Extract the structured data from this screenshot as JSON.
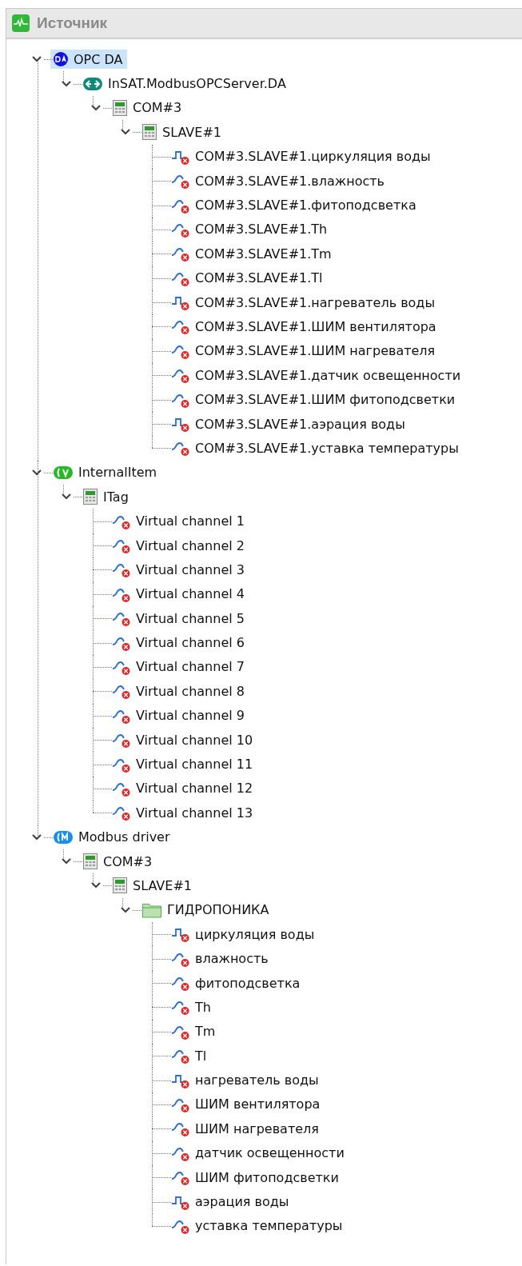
{
  "panel": {
    "title": "Источник"
  },
  "tree": [
    {
      "kind": "server",
      "label": "OPC DA",
      "expanded": true,
      "selected": true,
      "children": [
        {
          "kind": "opc",
          "label": "InSAT.ModbusOPCServer.DA",
          "expanded": true,
          "selected": false,
          "children": [
            {
              "kind": "device",
              "label": "COM#3",
              "expanded": true,
              "selected": false,
              "children": [
                {
                  "kind": "device",
                  "label": "SLAVE#1",
                  "expanded": true,
                  "selected": false,
                  "children": [
                    {
                      "kind": "discrete",
                      "label": "COM#3.SLAVE#1.циркуляция воды",
                      "error": true,
                      "selected": false
                    },
                    {
                      "kind": "analog",
                      "label": "COM#3.SLAVE#1.влажность",
                      "error": true,
                      "selected": false
                    },
                    {
                      "kind": "analog",
                      "label": "COM#3.SLAVE#1.фитоподсветка",
                      "error": true,
                      "selected": false
                    },
                    {
                      "kind": "analog",
                      "label": "COM#3.SLAVE#1.Th",
                      "error": true,
                      "selected": false
                    },
                    {
                      "kind": "analog",
                      "label": "COM#3.SLAVE#1.Tm",
                      "error": true,
                      "selected": false
                    },
                    {
                      "kind": "analog",
                      "label": "COM#3.SLAVE#1.Tl",
                      "error": true,
                      "selected": false
                    },
                    {
                      "kind": "discrete",
                      "label": "COM#3.SLAVE#1.нагреватель воды",
                      "error": true,
                      "selected": false
                    },
                    {
                      "kind": "analog",
                      "label": "COM#3.SLAVE#1.ШИМ вентилятора",
                      "error": true,
                      "selected": false
                    },
                    {
                      "kind": "analog",
                      "label": "COM#3.SLAVE#1.ШИМ нагревателя",
                      "error": true,
                      "selected": false
                    },
                    {
                      "kind": "analog",
                      "label": "COM#3.SLAVE#1.датчик освещенности",
                      "error": true,
                      "selected": false
                    },
                    {
                      "kind": "analog",
                      "label": "COM#3.SLAVE#1.ШИМ фитоподсветки",
                      "error": true,
                      "selected": false
                    },
                    {
                      "kind": "discrete",
                      "label": "COM#3.SLAVE#1.аэрация воды",
                      "error": true,
                      "selected": false
                    },
                    {
                      "kind": "analog",
                      "label": "COM#3.SLAVE#1.уставка температуры",
                      "error": true,
                      "selected": false
                    }
                  ]
                }
              ]
            }
          ]
        }
      ]
    },
    {
      "kind": "virtual",
      "label": "InternalItem",
      "expanded": true,
      "selected": false,
      "children": [
        {
          "kind": "device",
          "label": "ITag",
          "expanded": true,
          "selected": false,
          "children": [
            {
              "kind": "analog",
              "label": "Virtual channel 1",
              "error": true,
              "selected": false
            },
            {
              "kind": "analog",
              "label": "Virtual channel 2",
              "error": true,
              "selected": false
            },
            {
              "kind": "analog",
              "label": "Virtual channel 3",
              "error": true,
              "selected": false
            },
            {
              "kind": "analog",
              "label": "Virtual channel 4",
              "error": true,
              "selected": false
            },
            {
              "kind": "analog",
              "label": "Virtual channel 5",
              "error": true,
              "selected": false
            },
            {
              "kind": "analog",
              "label": "Virtual channel 6",
              "error": true,
              "selected": false
            },
            {
              "kind": "analog",
              "label": "Virtual channel 7",
              "error": true,
              "selected": false
            },
            {
              "kind": "analog",
              "label": "Virtual channel 8",
              "error": true,
              "selected": false
            },
            {
              "kind": "analog",
              "label": "Virtual channel 9",
              "error": true,
              "selected": false
            },
            {
              "kind": "analog",
              "label": "Virtual channel 10",
              "error": true,
              "selected": false
            },
            {
              "kind": "analog",
              "label": "Virtual channel 11",
              "error": true,
              "selected": false
            },
            {
              "kind": "analog",
              "label": "Virtual channel 12",
              "error": true,
              "selected": false
            },
            {
              "kind": "analog",
              "label": "Virtual channel 13",
              "error": true,
              "selected": false
            }
          ]
        }
      ]
    },
    {
      "kind": "modbus",
      "label": "Modbus driver",
      "expanded": true,
      "selected": false,
      "children": [
        {
          "kind": "device",
          "label": "COM#3",
          "expanded": true,
          "selected": false,
          "children": [
            {
              "kind": "device",
              "label": "SLAVE#1",
              "expanded": true,
              "selected": false,
              "children": [
                {
                  "kind": "folder",
                  "label": "ГИДРОПОНИКА",
                  "expanded": true,
                  "selected": false,
                  "children": [
                    {
                      "kind": "discrete",
                      "label": "циркуляция воды",
                      "error": true,
                      "selected": false
                    },
                    {
                      "kind": "analog",
                      "label": "влажность",
                      "error": true,
                      "selected": false
                    },
                    {
                      "kind": "analog",
                      "label": "фитоподсветка",
                      "error": true,
                      "selected": false
                    },
                    {
                      "kind": "analog",
                      "label": "Th",
                      "error": true,
                      "selected": false
                    },
                    {
                      "kind": "analog",
                      "label": "Tm",
                      "error": true,
                      "selected": false
                    },
                    {
                      "kind": "analog",
                      "label": "Tl",
                      "error": true,
                      "selected": false
                    },
                    {
                      "kind": "discrete",
                      "label": "нагреватель воды",
                      "error": true,
                      "selected": false
                    },
                    {
                      "kind": "analog",
                      "label": "ШИМ вентилятора",
                      "error": true,
                      "selected": false
                    },
                    {
                      "kind": "analog",
                      "label": "ШИМ нагревателя",
                      "error": true,
                      "selected": false
                    },
                    {
                      "kind": "analog",
                      "label": "датчик освещенности",
                      "error": true,
                      "selected": false
                    },
                    {
                      "kind": "analog",
                      "label": "ШИМ фитоподсветки",
                      "error": true,
                      "selected": false
                    },
                    {
                      "kind": "discrete",
                      "label": "аэрация воды",
                      "error": true,
                      "selected": false
                    },
                    {
                      "kind": "analog",
                      "label": "уставка температуры",
                      "error": true,
                      "selected": false
                    }
                  ]
                }
              ]
            }
          ]
        }
      ]
    }
  ]
}
